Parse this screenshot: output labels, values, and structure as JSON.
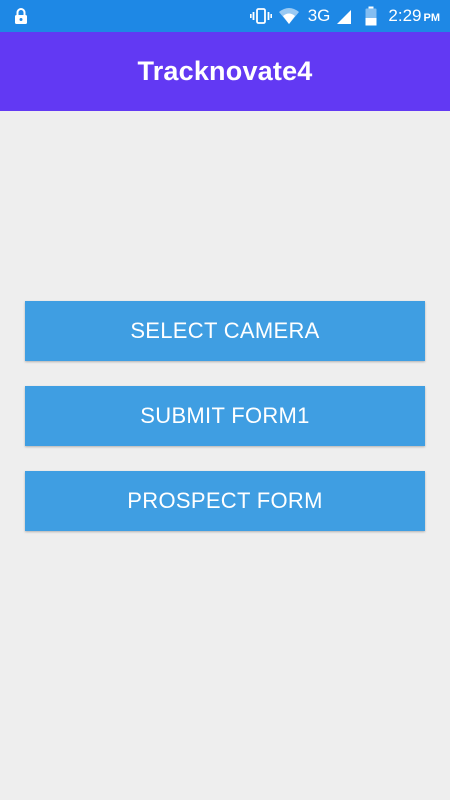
{
  "status_bar": {
    "network": "3G",
    "time": "2:29",
    "ampm": "PM",
    "icons": [
      "lock-icon",
      "vibrate-icon",
      "wifi-icon",
      "signal-icon",
      "battery-icon"
    ]
  },
  "app_bar": {
    "title": "Tracknovate4",
    "color": "#6239f3"
  },
  "buttons": [
    {
      "label": "SELECT CAMERA"
    },
    {
      "label": "SUBMIT FORM1"
    },
    {
      "label": "PROSPECT FORM"
    }
  ],
  "colors": {
    "status_bar": "#1e88e5",
    "button": "#3f9ee2",
    "background": "#eeeeee"
  }
}
